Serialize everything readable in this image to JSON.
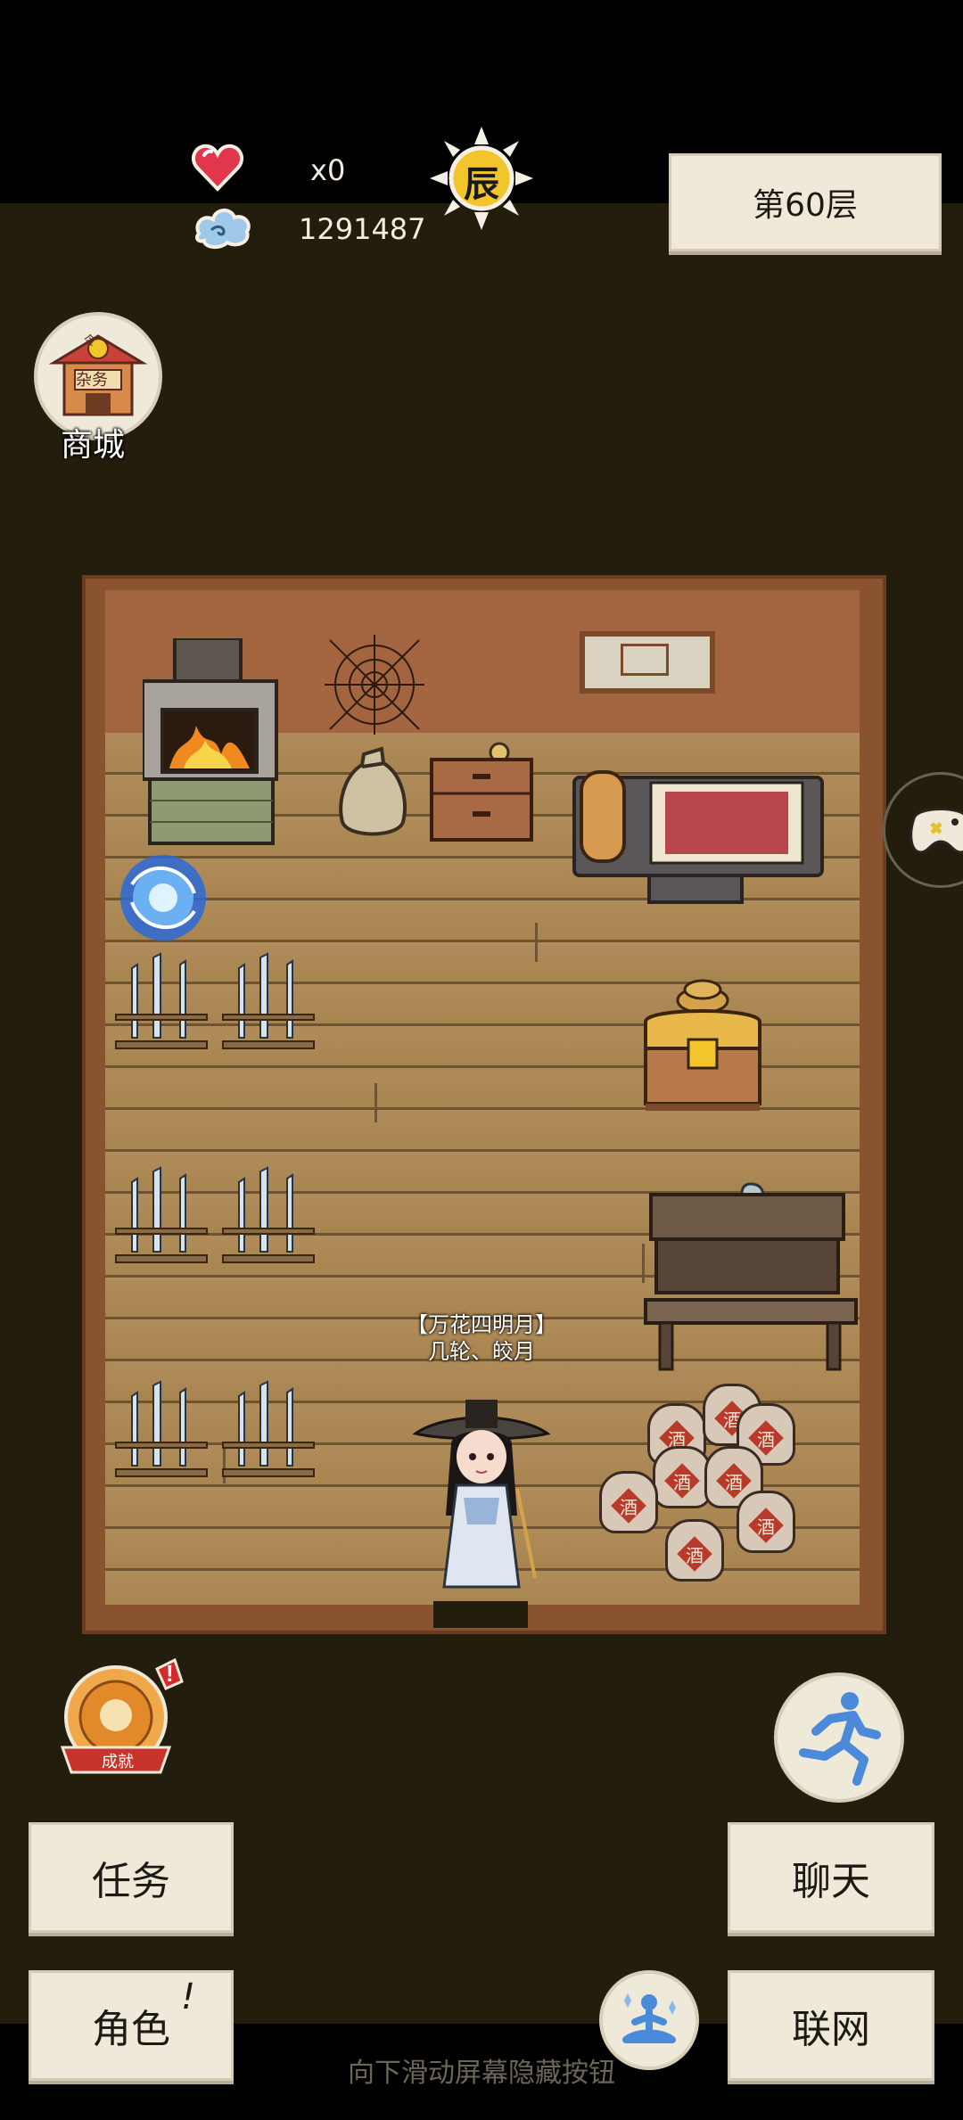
{
  "hud": {
    "lives_value": "x0",
    "currency_value": "1291487",
    "time_char": "辰",
    "floor_label": "第60层"
  },
  "shop": {
    "sign_char": "令",
    "banner_text": "杂务",
    "label": "商城"
  },
  "room": {
    "player_name_line1": "【万花四明月】",
    "player_name_line2": "几轮、皎月",
    "wine_jar_char": "酒"
  },
  "achievement": {
    "label": "成就",
    "alert": "!"
  },
  "buttons": {
    "task": "任务",
    "character": "角色",
    "character_alert": "!",
    "chat": "聊天",
    "network": "联网"
  },
  "hint_text": "向下滑动屏幕隐藏按钮",
  "icons": {
    "lives": "heart-icon",
    "currency": "cloud-icon",
    "time": "sun-icon",
    "shop": "shop-building-icon",
    "gamepad": "gamepad-icon",
    "run": "running-figure-icon",
    "meditate": "meditation-icon",
    "achievement": "achievement-medal-icon"
  },
  "colors": {
    "background": "#231d0d",
    "paper": "#efe9da",
    "wood_floor": "#b08c5b",
    "wall": "#a26540"
  }
}
